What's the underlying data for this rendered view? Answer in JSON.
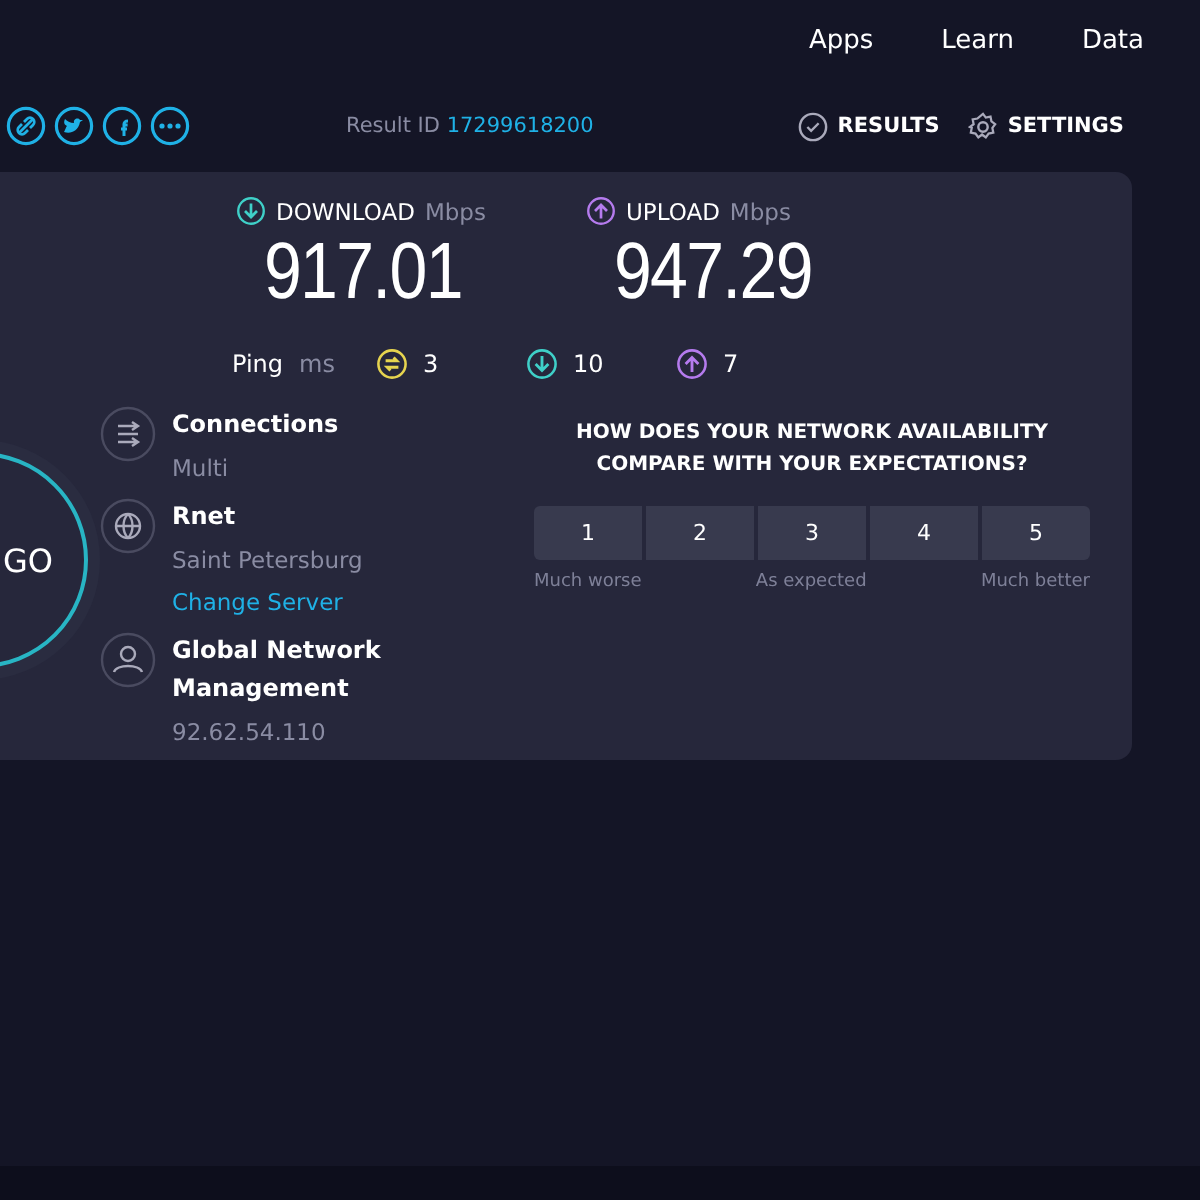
{
  "nav": [
    "Apps",
    "Learn",
    "Data"
  ],
  "result": {
    "label": "Result ID",
    "value": "17299618200"
  },
  "actions": [
    {
      "kind": "results",
      "label": "RESULTS"
    },
    {
      "kind": "settings",
      "label": "SETTINGS"
    }
  ],
  "speeds": [
    {
      "kind": "download",
      "label": "DOWNLOAD",
      "unit": "Mbps",
      "value": "917.01"
    },
    {
      "kind": "upload",
      "label": "UPLOAD",
      "unit": "Mbps",
      "value": "947.29"
    }
  ],
  "ping": {
    "label": "Ping",
    "unit": "ms",
    "readings": [
      {
        "kind": "idle",
        "value": "3"
      },
      {
        "kind": "download",
        "value": "10"
      },
      {
        "kind": "upload",
        "value": "7"
      }
    ]
  },
  "go_button": "GO",
  "info": [
    {
      "kind": "connections",
      "title": "Connections",
      "lines": [
        {
          "kind": "detail",
          "text": "Multi"
        }
      ]
    },
    {
      "kind": "server",
      "title": "Rnet",
      "lines": [
        {
          "kind": "detail",
          "text": "Saint Petersburg"
        },
        {
          "kind": "link",
          "text": "Change Server"
        }
      ]
    },
    {
      "kind": "provider",
      "title": "Global Network Management",
      "lines": [
        {
          "kind": "detail",
          "text": "92.62.54.110"
        }
      ]
    }
  ],
  "survey": {
    "question": "HOW DOES YOUR NETWORK AVAILABILITY COMPARE WITH YOUR EXPECTATIONS?",
    "options": [
      {
        "label": "1",
        "selected": false
      },
      {
        "label": "2",
        "selected": false
      },
      {
        "label": "3",
        "selected": false
      },
      {
        "label": "4",
        "selected": false
      },
      {
        "label": "5",
        "selected": false
      }
    ],
    "scale": [
      "Much worse",
      "As expected",
      "Much better"
    ]
  }
}
